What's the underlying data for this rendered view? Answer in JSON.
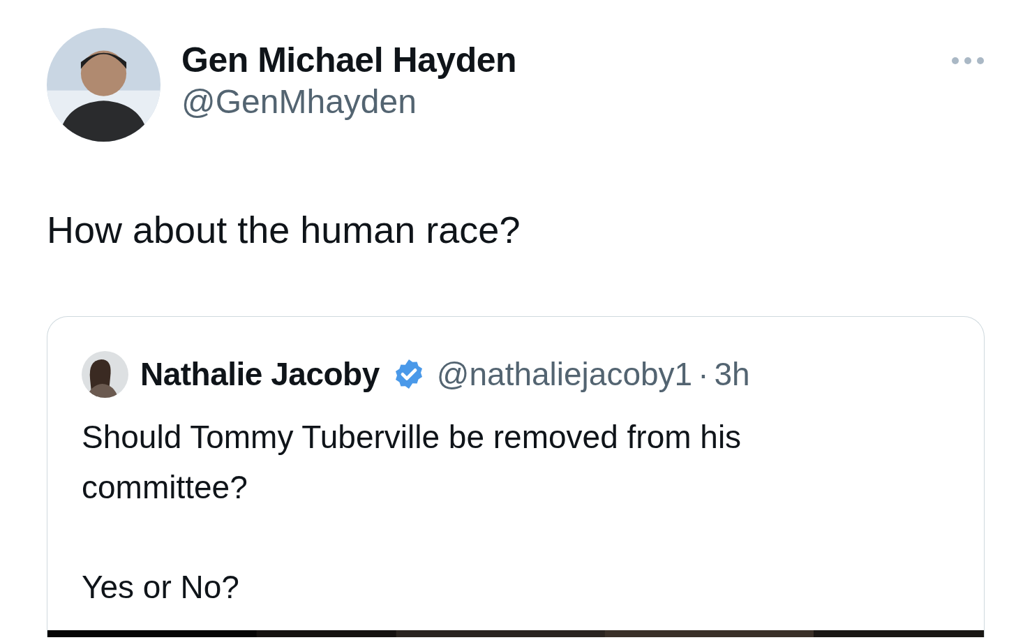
{
  "post": {
    "author": {
      "name": "Gen Michael Hayden",
      "handle": "@GenMhayden"
    },
    "text": "How about the human race?",
    "quote": {
      "author": {
        "name": "Nathalie Jacoby",
        "verified": true,
        "handle": "@nathaliejacoby1",
        "separator": "·",
        "time": "3h"
      },
      "paragraphs": [
        "Should Tommy Tuberville be removed from his committee?",
        "Yes or No?"
      ]
    }
  }
}
